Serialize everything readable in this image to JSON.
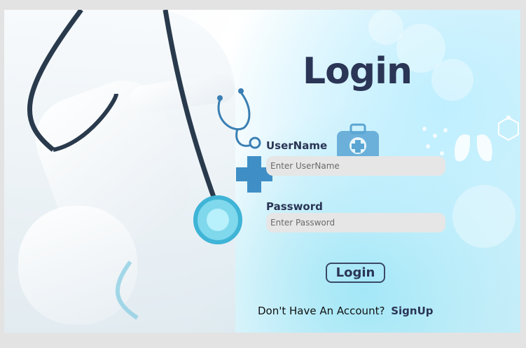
{
  "form": {
    "title": "Login",
    "username": {
      "label": "UserName",
      "placeholder": "Enter UserName",
      "value": ""
    },
    "password": {
      "label": "Password",
      "placeholder": "Enter Password",
      "value": ""
    },
    "submit_label": "Login",
    "signup_prompt": "Don't Have An Account?",
    "signup_link": "SignUp"
  },
  "theme": {
    "accent": "#2b3556",
    "input_bg": "#e6e6e6",
    "page_bg": "#e3e3e3"
  },
  "icons": [
    "stethoscope-icon",
    "medical-cross-icon",
    "medical-kit-icon",
    "lungs-icon",
    "molecule-icon"
  ]
}
